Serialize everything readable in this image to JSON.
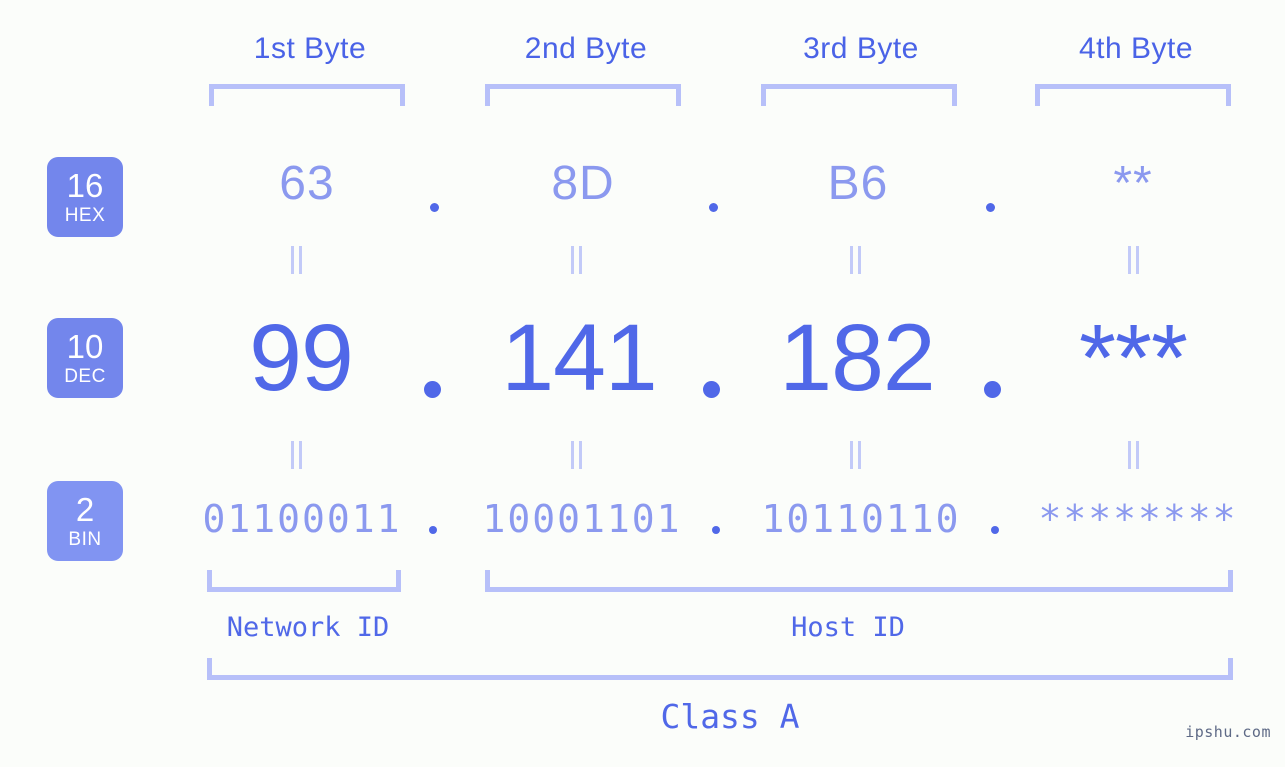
{
  "meta": {
    "background": "#fbfdfa",
    "accent_strong": "#5068e8",
    "accent_light": "#8b99ef",
    "accent_pale": "#b7c0f9",
    "watermark": "ipshu.com"
  },
  "byte_headers": [
    {
      "label": "1st Byte"
    },
    {
      "label": "2nd Byte"
    },
    {
      "label": "3rd Byte"
    },
    {
      "label": "4th Byte"
    }
  ],
  "rows": [
    {
      "key": "hex",
      "badge": {
        "number": "16",
        "name": "HEX",
        "color": "#7386ec"
      },
      "values": [
        "63",
        "8D",
        "B6",
        "**"
      ]
    },
    {
      "key": "dec",
      "badge": {
        "number": "10",
        "name": "DEC",
        "color": "#7386ec"
      },
      "values": [
        "99",
        "141",
        "182",
        "***"
      ]
    },
    {
      "key": "bin",
      "badge": {
        "number": "2",
        "name": "BIN",
        "color": "#8194f2"
      },
      "values": [
        "01100011",
        "10001101",
        "10110110",
        "********"
      ]
    }
  ],
  "separators": {
    "symbol": "."
  },
  "equality_marker": "||",
  "captions": {
    "network_id": "Network ID",
    "host_id": "Host ID",
    "class": "Class A"
  }
}
